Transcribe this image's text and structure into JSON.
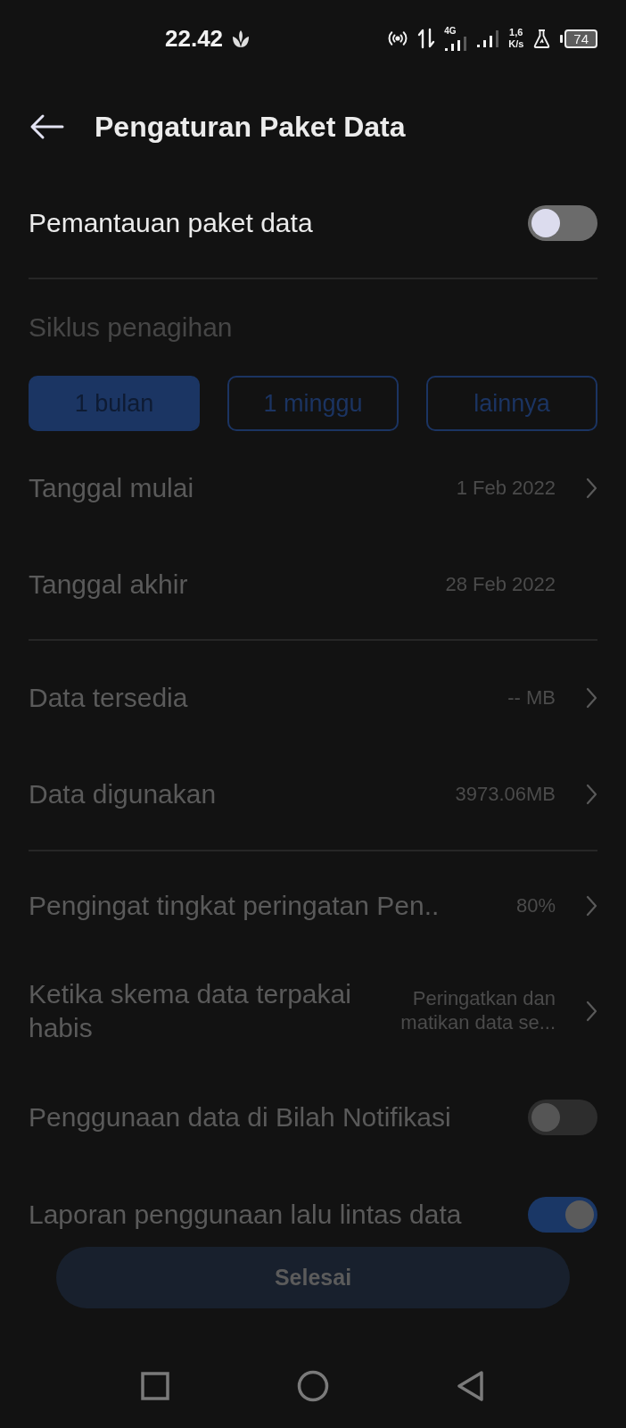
{
  "status_bar": {
    "time": "22.42",
    "network_type": "4G",
    "speed_value": "1,6",
    "speed_unit": "K/s",
    "battery": "74"
  },
  "header": {
    "title": "Pengaturan Paket Data"
  },
  "monitor": {
    "label": "Pemantauan paket data",
    "on": false
  },
  "groups": [
    {
      "title": "Siklus penagihan",
      "disabled": true,
      "segments": [
        {
          "label": "1 bulan",
          "selected": true
        },
        {
          "label": "1 minggu",
          "selected": false
        },
        {
          "label": "lainnya",
          "selected": false
        }
      ],
      "rows": [
        {
          "kind": "link",
          "label": "Tanggal mulai",
          "value": "1 Feb 2022",
          "disabled": true
        },
        {
          "kind": "info",
          "label": "Tanggal akhir",
          "value": "28 Feb 2022",
          "disabled": true
        }
      ]
    },
    {
      "rows": [
        {
          "kind": "link",
          "label": "Data tersedia",
          "value": "-- MB",
          "disabled": true
        },
        {
          "kind": "link",
          "label": "Data digunakan",
          "value": "3973.06MB",
          "disabled": true
        }
      ]
    },
    {
      "rows": [
        {
          "kind": "link",
          "label": "Pengingat tingkat peringatan Pen..",
          "value": "80%",
          "disabled": true
        },
        {
          "kind": "link",
          "label": "Ketika skema data terpakai habis",
          "value": "Peringatkan dan matikan data se...",
          "disabled": true
        },
        {
          "kind": "toggle",
          "label": "Penggunaan data di Bilah Notifikasi",
          "on": false,
          "disabled": true
        },
        {
          "kind": "toggle",
          "label": "Laporan penggunaan lalu lintas data",
          "on": true,
          "disabled": true
        }
      ]
    }
  ],
  "done_button": {
    "label": "Selesai",
    "disabled": true
  }
}
